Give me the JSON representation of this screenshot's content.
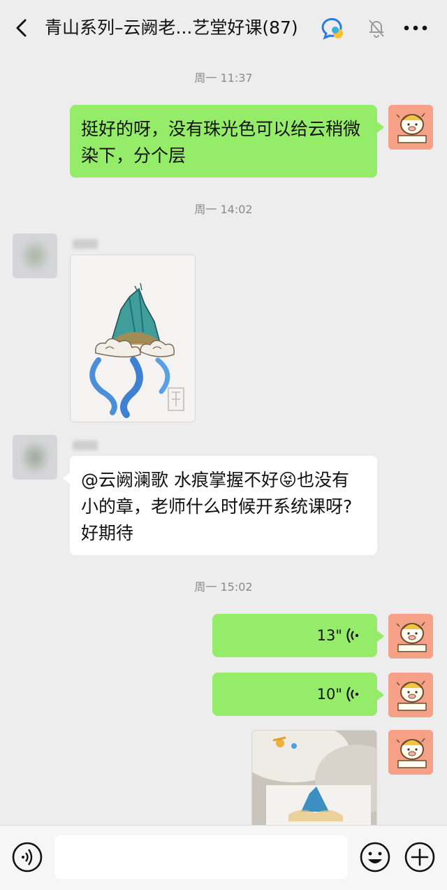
{
  "header": {
    "title": "青山系列–云阙老...艺堂好课(87)",
    "back_icon": "chevron-left-icon",
    "badge_icon": "group-chat-badge-icon",
    "mute_icon": "muted-bell-icon",
    "more_icon": "more-dots-icon"
  },
  "messages": {
    "t1": "周一 11:37",
    "m1": "挺好的呀，没有珠光色可以给云稍微染下，分个层",
    "t2": "周一 14:02",
    "t3_msg_prefix": "@云阙澜歌  水痕掌握不好",
    "t3_msg_emoji": "😝",
    "t3_msg_suffix": "也没有小的章，老师什么时候开系统课呀?好期待",
    "t3": "周一 15:02",
    "voice1": "13\"",
    "voice2": "10\""
  },
  "input": {
    "value": ""
  },
  "colors": {
    "background": "#ededed",
    "sent_bubble": "#95ec69",
    "received_bubble": "#ffffff",
    "my_avatar": "#f7a088",
    "timestamp": "#8a8a8a"
  },
  "icons": {
    "voice_input": "voice-input-icon",
    "emoji": "emoji-icon",
    "plus": "plus-icon"
  }
}
